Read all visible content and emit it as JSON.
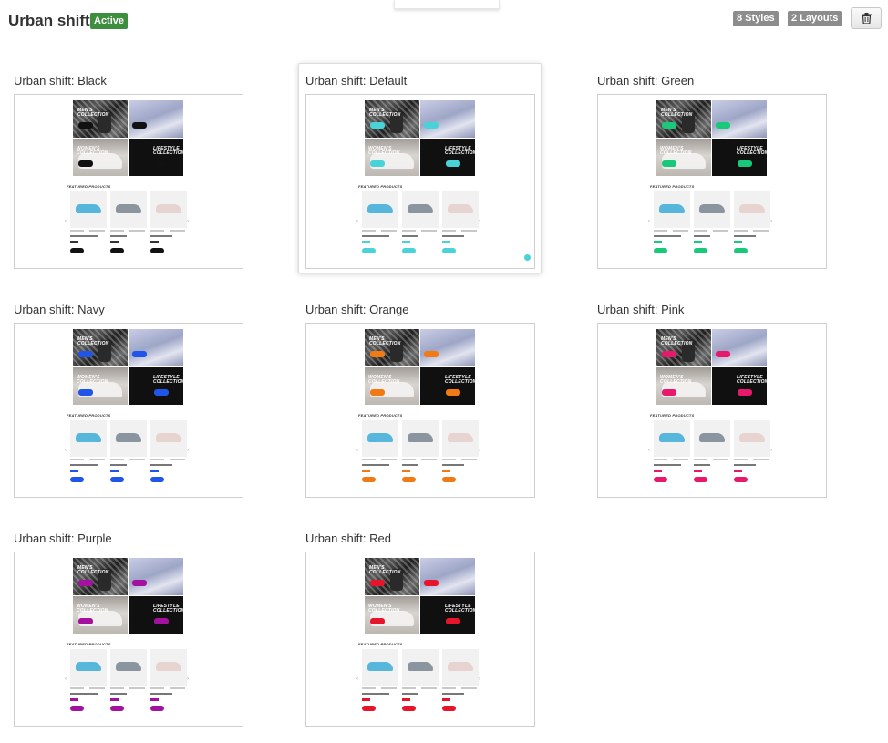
{
  "header": {
    "title": "Urban shift",
    "active_badge": "Active",
    "styles_count": "8 Styles",
    "layouts_count": "2 Layouts"
  },
  "styles": [
    {
      "name": "Urban shift: Black",
      "accent": "#111111",
      "hero1": "MEN'S COLLECTION",
      "hero2": "WOMEN'S COLLECTION",
      "hero3": "LIFESTYLE COLLECTION",
      "featured": "FEATURED PRODUCTS"
    },
    {
      "name": "Urban shift: Default",
      "accent": "#49d3d9",
      "hero1": "MEN'S COLLECTION",
      "hero2": "WOMEN'S COLLECTION",
      "hero3": "LIFESTYLE COLLECTION",
      "featured": "FEATURED PRODUCTS"
    },
    {
      "name": "Urban shift: Green",
      "accent": "#19c97a",
      "hero1": "MEN'S COLLECTION",
      "hero2": "WOMEN'S COLLECTION",
      "hero3": "LIFESTYLE COLLECTION",
      "featured": "FEATURED PRODUCTS"
    },
    {
      "name": "Urban shift: Navy",
      "accent": "#1f55e8",
      "hero1": "MEN'S COLLECTION",
      "hero2": "WOMEN'S COLLECTION",
      "hero3": "LIFESTYLE COLLECTION",
      "featured": "FEATURED PRODUCTS"
    },
    {
      "name": "Urban shift: Orange",
      "accent": "#f27a14",
      "hero1": "MEN'S COLLECTION",
      "hero2": "WOMEN'S COLLECTION",
      "hero3": "LIFESTYLE COLLECTION",
      "featured": "FEATURED PRODUCTS"
    },
    {
      "name": "Urban shift: Pink",
      "accent": "#e8196a",
      "hero1": "MEN'S COLLECTION",
      "hero2": "WOMEN'S COLLECTION",
      "hero3": "LIFESTYLE COLLECTION",
      "featured": "FEATURED PRODUCTS"
    },
    {
      "name": "Urban shift: Purple",
      "accent": "#a3119e",
      "hero1": "MEN'S COLLECTION",
      "hero2": "WOMEN'S COLLECTION",
      "hero3": "LIFESTYLE COLLECTION",
      "featured": "FEATURED PRODUCTS"
    },
    {
      "name": "Urban shift: Red",
      "accent": "#e8142b",
      "hero1": "MEN'S COLLECTION",
      "hero2": "WOMEN'S COLLECTION",
      "hero3": "LIFESTYLE COLLECTION",
      "featured": "FEATURED PRODUCTS"
    }
  ],
  "selected_style": "Urban shift: Default",
  "icons": {
    "delete": "trash-icon",
    "carousel_prev": "chevron-left-icon",
    "carousel_next": "chevron-right-icon"
  }
}
